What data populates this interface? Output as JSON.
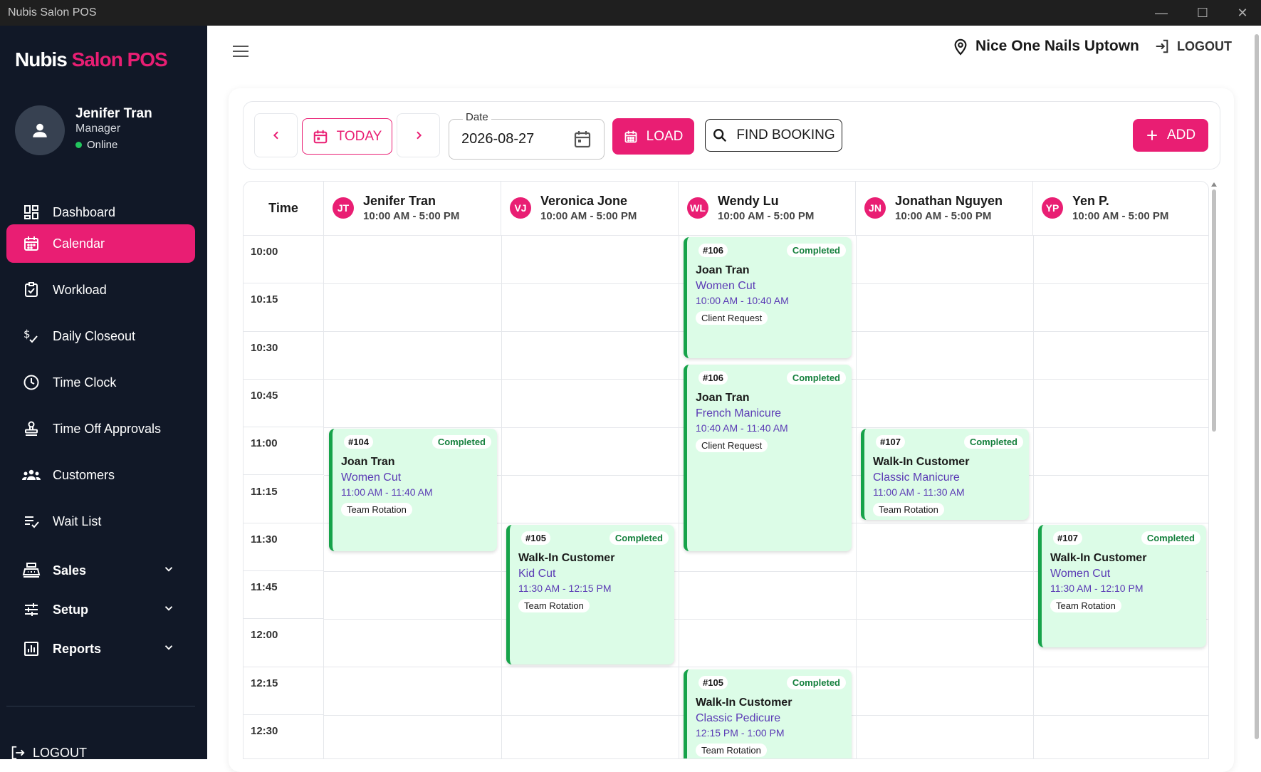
{
  "window": {
    "title": "Nubis Salon POS"
  },
  "sidebar": {
    "logo_part1": "Nubis",
    "logo_part2": "Salon POS",
    "user": {
      "name": "Jenifer Tran",
      "role": "Manager",
      "status": "Online"
    },
    "items": [
      {
        "label": "Dashboard",
        "icon": "dashboard-icon"
      },
      {
        "label": "Calendar",
        "icon": "calendar-icon",
        "active": true
      },
      {
        "label": "Workload",
        "icon": "clipboard-check-icon"
      },
      {
        "label": "Daily Closeout",
        "icon": "dollar-check-icon"
      },
      {
        "label": "Time Clock",
        "icon": "clock-icon"
      },
      {
        "label": "Time Off Approvals",
        "icon": "stamp-icon"
      },
      {
        "label": "Customers",
        "icon": "people-icon"
      },
      {
        "label": "Wait List",
        "icon": "list-check-icon"
      }
    ],
    "sections": [
      {
        "label": "Sales",
        "icon": "register-icon"
      },
      {
        "label": "Setup",
        "icon": "sliders-icon"
      },
      {
        "label": "Reports",
        "icon": "chart-icon"
      }
    ],
    "logout_label": "LOGOUT"
  },
  "header": {
    "location": "Nice One Nails Uptown",
    "logout_label": "LOGOUT"
  },
  "toolbar": {
    "today_label": "TODAY",
    "date_label": "Date",
    "date_value": "2026-08-27",
    "load_label": "LOAD",
    "find_label": "FIND BOOKING",
    "add_label": "ADD"
  },
  "calendar": {
    "time_header": "Time",
    "staff": [
      {
        "initials": "JT",
        "name": "Jenifer Tran",
        "hours": "10:00 AM - 5:00 PM"
      },
      {
        "initials": "VJ",
        "name": "Veronica Jone",
        "hours": "10:00 AM - 5:00 PM"
      },
      {
        "initials": "WL",
        "name": "Wendy Lu",
        "hours": "10:00 AM - 5:00 PM"
      },
      {
        "initials": "JN",
        "name": "Jonathan Nguyen",
        "hours": "10:00 AM - 5:00 PM"
      },
      {
        "initials": "YP",
        "name": "Yen P.",
        "hours": "10:00 AM - 5:00 PM"
      }
    ],
    "times": [
      "10:00",
      "10:15",
      "10:30",
      "10:45",
      "11:00",
      "11:15",
      "11:30",
      "11:45",
      "12:00",
      "12:15",
      "12:30"
    ],
    "appointments": [
      {
        "num": "#106",
        "status": "Completed",
        "customer": "Joan Tran",
        "service": "Women Cut",
        "time": "10:00 AM - 10:40 AM",
        "tag": "Client Request"
      },
      {
        "num": "#106",
        "status": "Completed",
        "customer": "Joan Tran",
        "service": "French Manicure",
        "time": "10:40 AM - 11:40 AM",
        "tag": "Client Request"
      },
      {
        "num": "#104",
        "status": "Completed",
        "customer": "Joan Tran",
        "service": "Women Cut",
        "time": "11:00 AM - 11:40 AM",
        "tag": "Team Rotation"
      },
      {
        "num": "#107",
        "status": "Completed",
        "customer": "Walk-In Customer",
        "service": "Classic Manicure",
        "time": "11:00 AM - 11:30 AM",
        "tag": "Team Rotation"
      },
      {
        "num": "#105",
        "status": "Completed",
        "customer": "Walk-In Customer",
        "service": "Kid Cut",
        "time": "11:30 AM - 12:15 PM",
        "tag": "Team Rotation"
      },
      {
        "num": "#107",
        "status": "Completed",
        "customer": "Walk-In Customer",
        "service": "Women Cut",
        "time": "11:30 AM - 12:10 PM",
        "tag": "Team Rotation"
      },
      {
        "num": "#105",
        "status": "Completed",
        "customer": "Walk-In Customer",
        "service": "Classic Pedicure",
        "time": "12:15 PM - 1:00 PM",
        "tag": "Team Rotation"
      }
    ]
  },
  "colors": {
    "accent": "#e91e73",
    "sidebar_bg": "#111827",
    "appt_bg": "#dcfce7",
    "appt_border": "#16a34a",
    "service_text": "#5b3bb5"
  }
}
